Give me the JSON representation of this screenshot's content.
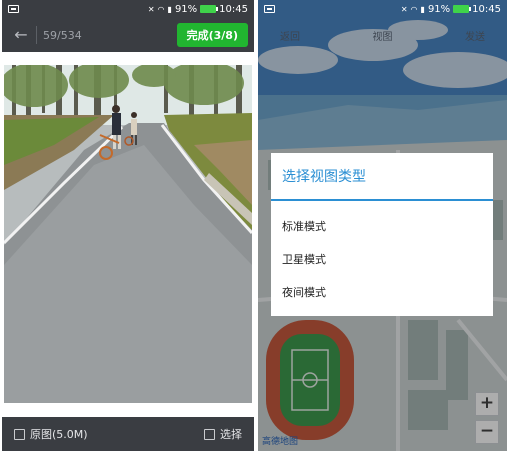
{
  "left": {
    "status": {
      "battery": "91%",
      "time": "10:45"
    },
    "appbar": {
      "counter": "59/534",
      "done_label": "完成(3/8)"
    },
    "bottombar": {
      "original_label": "原图(5.0M)",
      "select_label": "选择"
    }
  },
  "right": {
    "status": {
      "battery": "91%",
      "time": "10:45"
    },
    "map_top": {
      "left": "返回",
      "middle": "视图",
      "right": "发送"
    },
    "dialog": {
      "title": "选择视图类型",
      "options": [
        "标准模式",
        "卫星模式",
        "夜间模式"
      ]
    },
    "zoom": {
      "in": "+",
      "out": "−"
    },
    "map_logo": "高德地图"
  },
  "colors": {
    "done_green": "#21b530",
    "dialog_accent": "#2b8fd3",
    "battery_green": "#3fd34a"
  }
}
